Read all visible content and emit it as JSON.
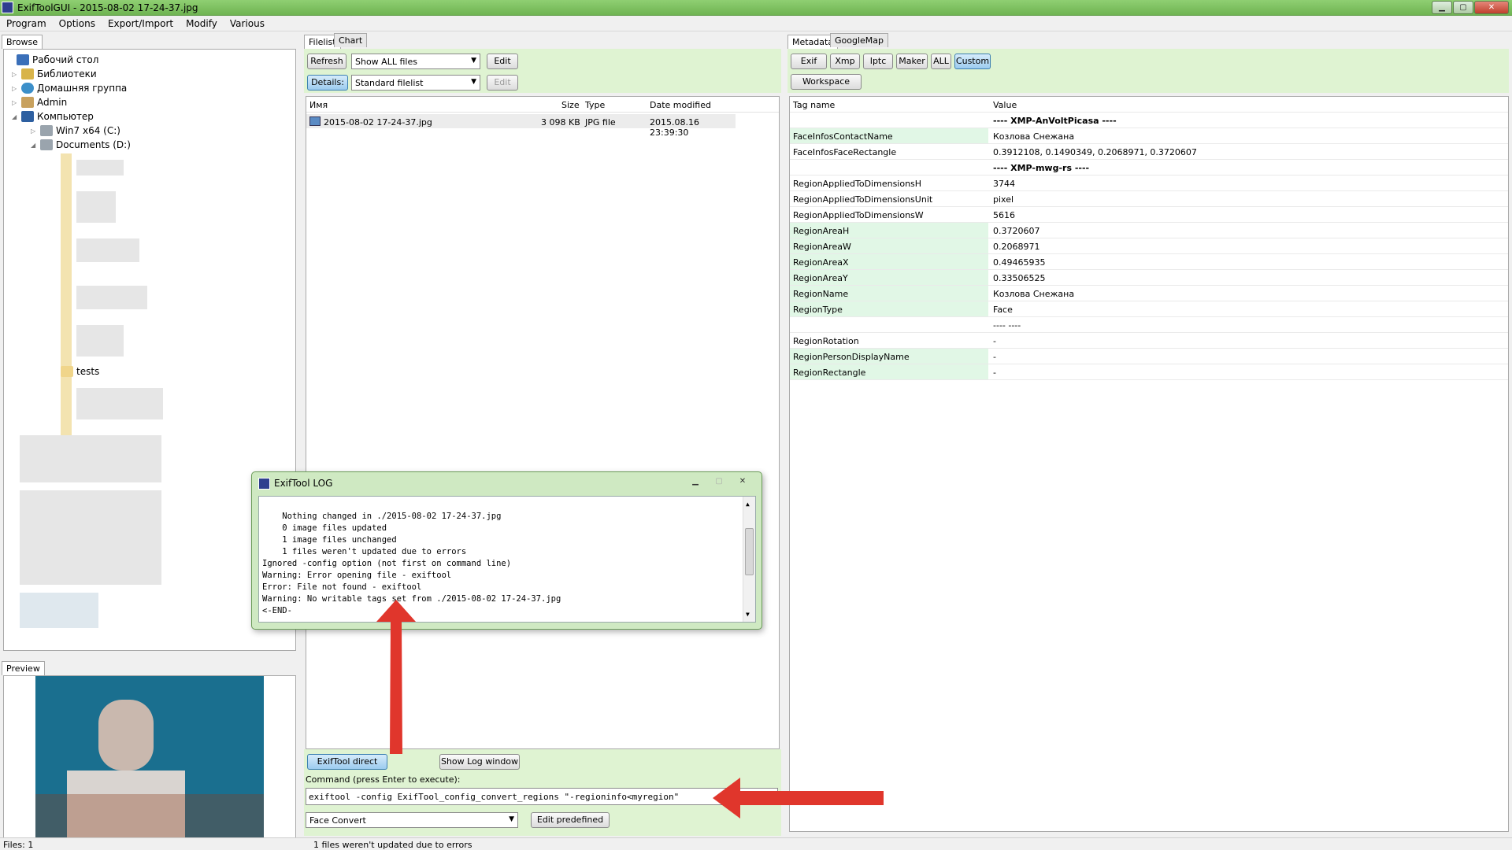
{
  "window": {
    "title": "ExifToolGUI - 2015-08-02 17-24-37.jpg"
  },
  "menu": [
    "Program",
    "Options",
    "Export/Import",
    "Modify",
    "Various"
  ],
  "left": {
    "tab_browse": "Browse",
    "tree": [
      {
        "label": "Рабочий стол",
        "icon": "desktop-icon",
        "arrow": ""
      },
      {
        "label": "Библиотеки",
        "icon": "library-icon",
        "arrow": "▷"
      },
      {
        "label": "Домашняя группа",
        "icon": "homegroup-icon",
        "arrow": "▷"
      },
      {
        "label": "Admin",
        "icon": "user-folder-icon",
        "arrow": "▷"
      },
      {
        "label": "Компьютер",
        "icon": "computer-icon",
        "arrow": "◢"
      },
      {
        "label": "Win7 x64 (C:)",
        "icon": "drive-icon",
        "arrow": "▷"
      },
      {
        "label": "Documents (D:)",
        "icon": "drive-icon",
        "arrow": "◢"
      },
      {
        "label": "tests",
        "icon": "folder-icon",
        "arrow": ""
      }
    ],
    "tab_preview": "Preview"
  },
  "middle": {
    "tab_filelist": "Filelist",
    "tab_chart": "Chart",
    "refresh": "Refresh",
    "filter": "Show ALL files",
    "edit": "Edit",
    "details": "Details:",
    "view": "Standard filelist",
    "edit2": "Edit",
    "columns": {
      "name": "Имя",
      "size": "Size",
      "type": "Type",
      "date": "Date modified"
    },
    "file": {
      "name": "2015-08-02 17-24-37.jpg",
      "size": "3 098 KB",
      "type": "JPG file",
      "date": "2015.08.16 23:39:30"
    },
    "exiftool_direct": "ExifTool direct",
    "show_log": "Show Log window",
    "command_label": "Command (press Enter to execute):",
    "command_value": "exiftool -config ExifTool_config_convert_regions \"-regioninfo<myregion\"",
    "predefined": "Face Convert",
    "edit_predefined": "Edit predefined"
  },
  "right": {
    "tab_metadata": "Metadata",
    "tab_googlemap": "GoogleMap",
    "buttons": [
      "Exif",
      "Xmp",
      "Iptc",
      "Maker",
      "ALL",
      "Custom"
    ],
    "workspace": "Workspace",
    "col_tag": "Tag name",
    "col_value": "Value",
    "rows": [
      {
        "tag": "",
        "value": "---- XMP-AnVoltPicasa ----",
        "group": true,
        "hl": false
      },
      {
        "tag": "FaceInfosContactName",
        "value": "Козлова Снежана",
        "group": false,
        "hl": true
      },
      {
        "tag": "FaceInfosFaceRectangle",
        "value": "0.3912108, 0.1490349, 0.2068971, 0.3720607",
        "group": false,
        "hl": false
      },
      {
        "tag": "",
        "value": "---- XMP-mwg-rs ----",
        "group": true,
        "hl": false
      },
      {
        "tag": "RegionAppliedToDimensionsH",
        "value": "3744",
        "group": false,
        "hl": false
      },
      {
        "tag": "RegionAppliedToDimensionsUnit",
        "value": "pixel",
        "group": false,
        "hl": false
      },
      {
        "tag": "RegionAppliedToDimensionsW",
        "value": "5616",
        "group": false,
        "hl": false
      },
      {
        "tag": "RegionAreaH",
        "value": "0.3720607",
        "group": false,
        "hl": true
      },
      {
        "tag": "RegionAreaW",
        "value": "0.2068971",
        "group": false,
        "hl": true
      },
      {
        "tag": "RegionAreaX",
        "value": "0.49465935",
        "group": false,
        "hl": true
      },
      {
        "tag": "RegionAreaY",
        "value": "0.33506525",
        "group": false,
        "hl": true
      },
      {
        "tag": "RegionName",
        "value": "Козлова Снежана",
        "group": false,
        "hl": true
      },
      {
        "tag": "RegionType",
        "value": "Face",
        "group": false,
        "hl": true
      },
      {
        "tag": "",
        "value": "---- ----",
        "group": false,
        "hl": false
      },
      {
        "tag": "RegionRotation",
        "value": "-",
        "group": false,
        "hl": false
      },
      {
        "tag": "RegionPersonDisplayName",
        "value": "-",
        "group": false,
        "hl": true
      },
      {
        "tag": "RegionRectangle",
        "value": "-",
        "group": false,
        "hl": true
      }
    ]
  },
  "log": {
    "title": "ExifTool LOG",
    "text": "Nothing changed in ./2015-08-02 17-24-37.jpg\n    0 image files updated\n    1 image files unchanged\n    1 files weren't updated due to errors\nIgnored -config option (not first on command line)\nWarning: Error opening file - exiftool\nError: File not found - exiftool\nWarning: No writable tags set from ./2015-08-02 17-24-37.jpg\n<-END-"
  },
  "status": {
    "files": "Files: 1",
    "message": "1 files weren't updated due to errors"
  },
  "colors": {
    "accent_green": "#dff3d2",
    "arrow_red": "#e0362c",
    "highlight_row": "#e1f7e6"
  }
}
